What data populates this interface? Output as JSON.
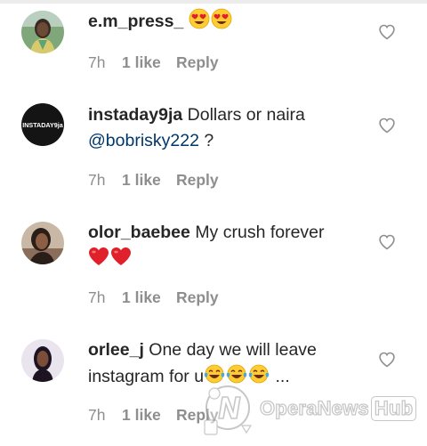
{
  "comments": [
    {
      "username": "e.m_press_",
      "text": "",
      "text_line2": "",
      "emojis": [
        "heart-eyes",
        "heart-eyes"
      ],
      "time": "7h",
      "likes": "1 like",
      "reply_label": "Reply"
    },
    {
      "username": "instaday9ja",
      "text": "Dollars or naira",
      "mention": "@bobrisky222",
      "text_after_mention": " ?",
      "avatar_logo_text": "INSTADAY9ja",
      "time": "7h",
      "likes": "1 like",
      "reply_label": "Reply"
    },
    {
      "username": "olor_baebee",
      "text": "My crush forever",
      "emojis": [
        "red-heart",
        "red-heart"
      ],
      "time": "7h",
      "likes": "1 like",
      "reply_label": "Reply"
    },
    {
      "username": "orlee_j",
      "text": "One day we will leave",
      "text_line2": "instagram for u",
      "emojis": [
        "tears-of-joy",
        "tears-of-joy",
        "tears-of-joy"
      ],
      "text_tail": " ...",
      "time": "7h",
      "likes": "1 like",
      "reply_label": "Reply"
    }
  ],
  "watermark": {
    "brand": "OperaNews",
    "brand_suffix": "Hub"
  },
  "colors": {
    "text": "#262626",
    "meta": "#8e8e8e",
    "mention": "#00376b",
    "heart_red": "#e0202a",
    "emoji_yellow": "#ffcc33"
  }
}
